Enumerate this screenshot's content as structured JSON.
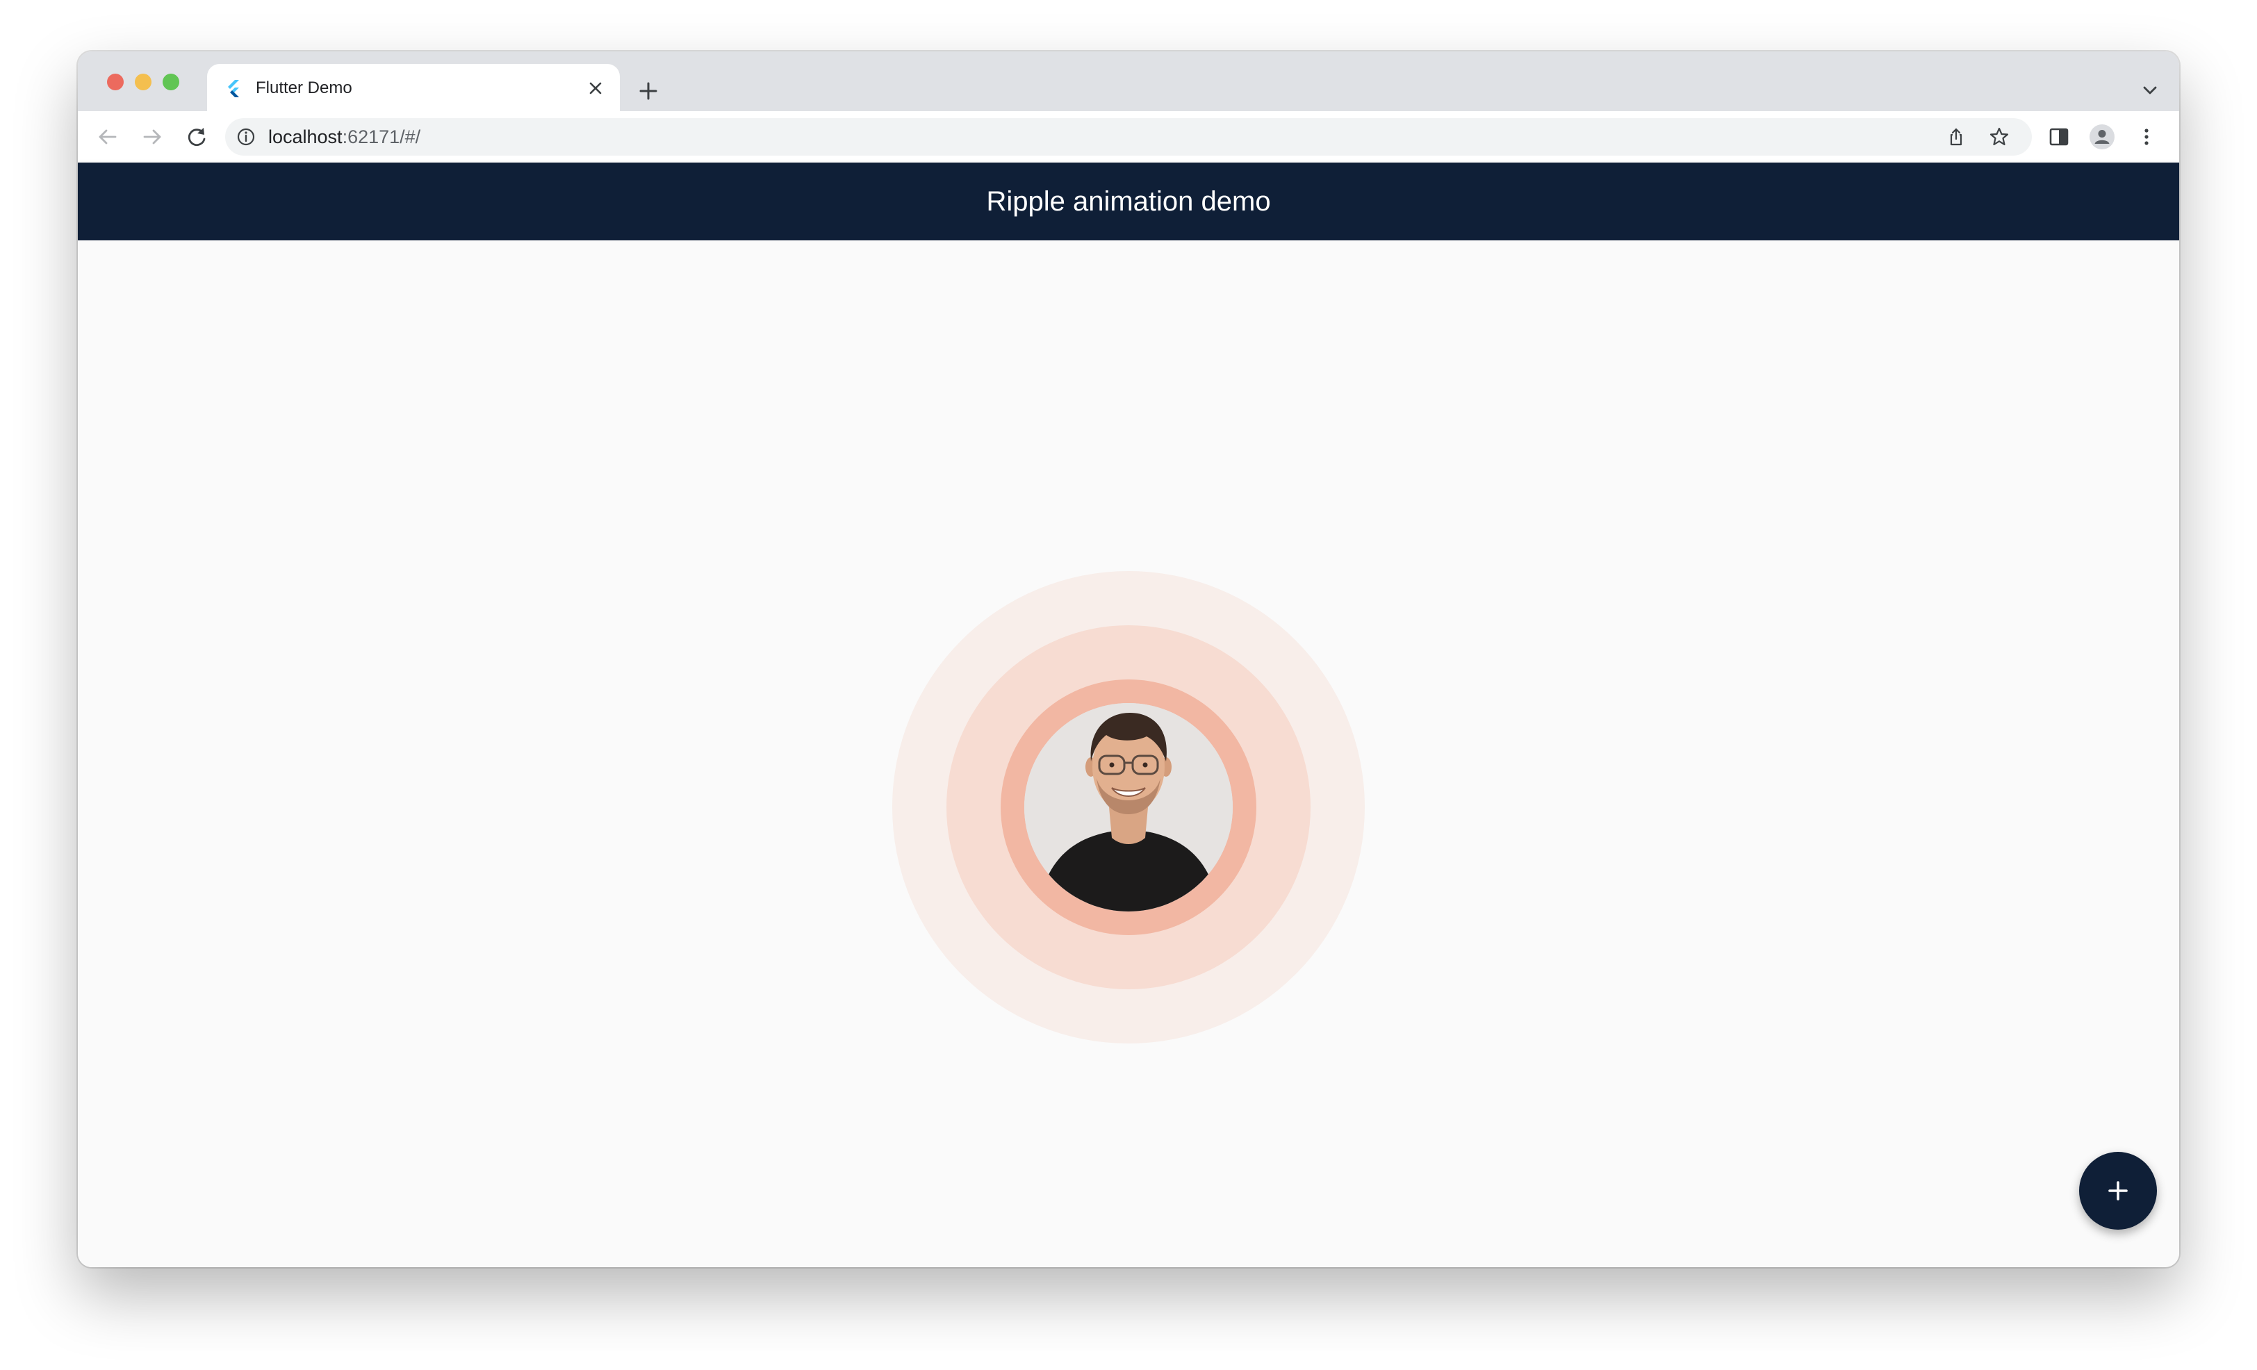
{
  "browser": {
    "tab": {
      "title": "Flutter Demo",
      "favicon": "flutter-logo-icon"
    },
    "omnibox": {
      "url_host": "localhost",
      "url_rest": ":62171/#/"
    },
    "icons": {
      "close": "close-icon",
      "new_tab": "plus-icon",
      "tab_search": "chevron-down-icon",
      "back": "arrow-left-icon",
      "forward": "arrow-right-icon",
      "reload": "reload-icon",
      "site_info": "info-icon",
      "share": "share-icon",
      "bookmark": "star-icon",
      "side_panel": "side-panel-icon",
      "profile": "profile-icon",
      "menu": "kebab-menu-icon"
    }
  },
  "app": {
    "title": "Ripple animation demo",
    "fab_icon": "plus-icon",
    "colors": {
      "primary": "#0f1f37",
      "background": "#fafafa",
      "ripple_outer": "#f8eeea",
      "ripple_mid": "#f7dcd2",
      "ripple_inner": "#f2b7a3"
    }
  }
}
